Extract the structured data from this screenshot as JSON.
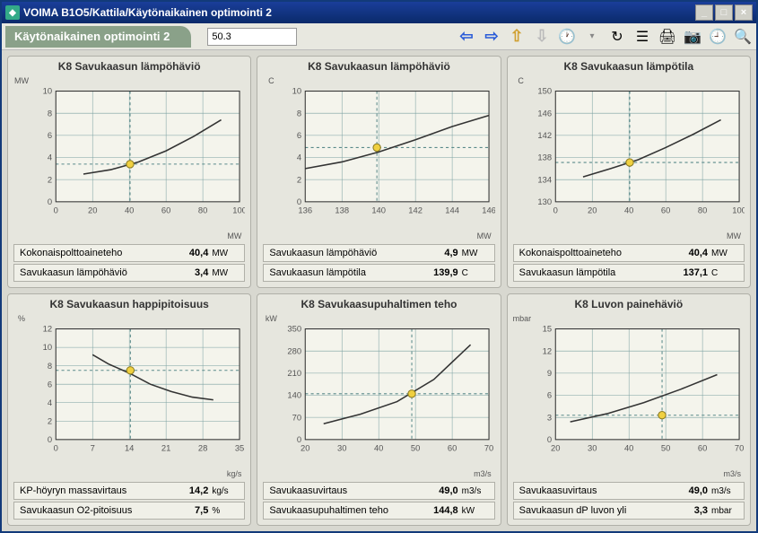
{
  "window": {
    "title": "VOIMA B1O5/Kattila/Käytönaikainen optimointi 2"
  },
  "toolbar": {
    "breadcrumb": "Käytönaikainen optimointi 2",
    "input_value": "50.3"
  },
  "panels": [
    {
      "title": "K8 Savukaasun lämpöhäviö",
      "ylabel": "MW",
      "xlabel": "MW",
      "rows": [
        {
          "label": "Kokonaispolttoaineteho",
          "value": "40,4",
          "unit": "MW"
        },
        {
          "label": "Savukaasun lämpöhäviö",
          "value": "3,4",
          "unit": "MW"
        }
      ]
    },
    {
      "title": "K8 Savukaasun lämpöhäviö",
      "ylabel": "C",
      "xlabel": "MW",
      "rows": [
        {
          "label": "Savukaasun lämpöhäviö",
          "value": "4,9",
          "unit": "MW"
        },
        {
          "label": "Savukaasun lämpötila",
          "value": "139,9",
          "unit": "C"
        }
      ]
    },
    {
      "title": "K8 Savukaasun lämpötila",
      "ylabel": "C",
      "xlabel": "MW",
      "rows": [
        {
          "label": "Kokonaispolttoaineteho",
          "value": "40,4",
          "unit": "MW"
        },
        {
          "label": "Savukaasun lämpötila",
          "value": "137,1",
          "unit": "C"
        }
      ]
    },
    {
      "title": "K8 Savukaasun happipitoisuus",
      "ylabel": "%",
      "xlabel": "kg/s",
      "rows": [
        {
          "label": "KP-höyryn massavirtaus",
          "value": "14,2",
          "unit": "kg/s"
        },
        {
          "label": "Savukaasun O2-pitoisuus",
          "value": "7,5",
          "unit": "%"
        }
      ]
    },
    {
      "title": "K8 Savukaasupuhaltimen teho",
      "ylabel": "kW",
      "xlabel": "m3/s",
      "rows": [
        {
          "label": "Savukaasuvirtaus",
          "value": "49,0",
          "unit": "m3/s"
        },
        {
          "label": "Savukaasupuhaltimen teho",
          "value": "144,8",
          "unit": "kW"
        }
      ]
    },
    {
      "title": "K8 Luvon painehäviö",
      "ylabel": "mbar",
      "xlabel": "m3/s",
      "rows": [
        {
          "label": "Savukaasuvirtaus",
          "value": "49,0",
          "unit": "m3/s"
        },
        {
          "label": "Savukaasun dP luvon yli",
          "value": "3,3",
          "unit": "mbar"
        }
      ]
    }
  ],
  "chart_data": [
    {
      "type": "line",
      "title": "K8 Savukaasun lämpöhäviö",
      "xlabel": "MW",
      "ylabel": "MW",
      "xlim": [
        0,
        100
      ],
      "ylim": [
        0,
        10
      ],
      "xticks": [
        0,
        20,
        40,
        60,
        80,
        100
      ],
      "yticks": [
        0,
        2,
        4,
        6,
        8,
        10
      ],
      "x": [
        15,
        30,
        45,
        60,
        75,
        90
      ],
      "y": [
        2.5,
        2.9,
        3.6,
        4.6,
        5.9,
        7.4
      ],
      "marker": {
        "x": 40.4,
        "y": 3.4
      }
    },
    {
      "type": "line",
      "title": "K8 Savukaasun lämpöhäviö",
      "xlabel": "MW",
      "ylabel": "C",
      "xlim": [
        136,
        146
      ],
      "ylim": [
        0,
        10
      ],
      "xticks": [
        136,
        138,
        140,
        142,
        144,
        146
      ],
      "yticks": [
        0,
        2,
        4,
        6,
        8,
        10
      ],
      "x": [
        136,
        138,
        140,
        142,
        144,
        146
      ],
      "y": [
        3.0,
        3.6,
        4.5,
        5.6,
        6.8,
        7.8
      ],
      "marker": {
        "x": 139.9,
        "y": 4.9
      }
    },
    {
      "type": "line",
      "title": "K8 Savukaasun lämpötila",
      "xlabel": "MW",
      "ylabel": "C",
      "xlim": [
        0,
        100
      ],
      "ylim": [
        130,
        150
      ],
      "xticks": [
        0,
        20,
        40,
        60,
        80,
        100
      ],
      "yticks": [
        130,
        134,
        138,
        142,
        146,
        150
      ],
      "x": [
        15,
        30,
        45,
        60,
        75,
        90
      ],
      "y": [
        134.5,
        136.0,
        137.6,
        139.8,
        142.2,
        144.8
      ],
      "marker": {
        "x": 40.4,
        "y": 137.1
      }
    },
    {
      "type": "line",
      "title": "K8 Savukaasun happipitoisuus",
      "xlabel": "kg/s",
      "ylabel": "%",
      "xlim": [
        0,
        35
      ],
      "ylim": [
        0,
        12
      ],
      "xticks": [
        0,
        7,
        14,
        21,
        28,
        35
      ],
      "yticks": [
        0,
        2,
        4,
        6,
        8,
        10,
        12
      ],
      "x": [
        7,
        10,
        14,
        18,
        22,
        26,
        30
      ],
      "y": [
        9.2,
        8.2,
        7.2,
        6.0,
        5.2,
        4.6,
        4.3
      ],
      "marker": {
        "x": 14.2,
        "y": 7.5
      }
    },
    {
      "type": "line",
      "title": "K8 Savukaasupuhaltimen teho",
      "xlabel": "m3/s",
      "ylabel": "kW",
      "xlim": [
        20,
        70
      ],
      "ylim": [
        0,
        350
      ],
      "xticks": [
        20,
        30,
        40,
        50,
        60,
        70
      ],
      "yticks": [
        0,
        70,
        140,
        210,
        280,
        350
      ],
      "x": [
        25,
        35,
        45,
        55,
        65
      ],
      "y": [
        50,
        80,
        120,
        190,
        300
      ],
      "marker": {
        "x": 49.0,
        "y": 144.8
      }
    },
    {
      "type": "line",
      "title": "K8 Luvon painehäviö",
      "xlabel": "m3/s",
      "ylabel": "mbar",
      "xlim": [
        20,
        70
      ],
      "ylim": [
        0,
        15
      ],
      "xticks": [
        20,
        30,
        40,
        50,
        60,
        70
      ],
      "yticks": [
        0,
        3,
        6,
        9,
        12,
        15
      ],
      "x": [
        24,
        34,
        44,
        54,
        64
      ],
      "y": [
        2.4,
        3.5,
        5.0,
        6.8,
        8.8
      ],
      "marker": {
        "x": 49.0,
        "y": 3.3
      }
    }
  ]
}
